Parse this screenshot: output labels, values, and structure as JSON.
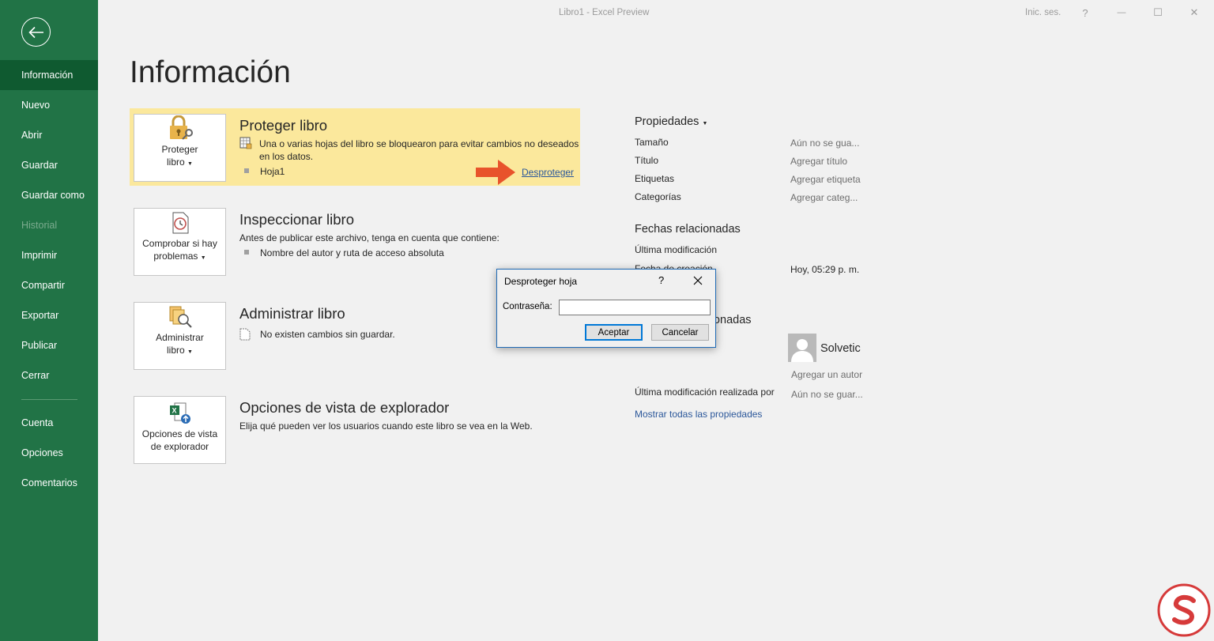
{
  "window": {
    "title": "Libro1  -  Excel Preview",
    "sign_in": "Inic. ses.",
    "help_glyph": "?",
    "minimize_glyph": "—",
    "maximize_glyph": "☐",
    "close_glyph": "✕"
  },
  "sidebar": {
    "items": [
      {
        "label": "Información",
        "state": "active"
      },
      {
        "label": "Nuevo",
        "state": "normal"
      },
      {
        "label": "Abrir",
        "state": "normal"
      },
      {
        "label": "Guardar",
        "state": "normal"
      },
      {
        "label": "Guardar como",
        "state": "normal"
      },
      {
        "label": "Historial",
        "state": "disabled"
      },
      {
        "label": "Imprimir",
        "state": "normal"
      },
      {
        "label": "Compartir",
        "state": "normal"
      },
      {
        "label": "Exportar",
        "state": "normal"
      },
      {
        "label": "Publicar",
        "state": "normal"
      },
      {
        "label": "Cerrar",
        "state": "normal"
      },
      {
        "label": "Cuenta",
        "state": "normal"
      },
      {
        "label": "Opciones",
        "state": "normal"
      },
      {
        "label": "Comentarios",
        "state": "normal"
      }
    ]
  },
  "page": {
    "title": "Información"
  },
  "sections": {
    "protect": {
      "button_line1": "Proteger",
      "button_line2": "libro",
      "title": "Proteger libro",
      "desc_line1": "Una o varias hojas del libro se bloquearon para evitar cambios no deseados",
      "desc_line2": "en los datos.",
      "sheet": "Hoja1",
      "unprotect_link": "Desproteger",
      "highlight_color": "#fbe89c"
    },
    "inspect": {
      "button_line1": "Comprobar si hay",
      "button_line2": "problemas",
      "title": "Inspeccionar libro",
      "desc": "Antes de publicar este archivo, tenga en cuenta que contiene:",
      "item": "Nombre del autor y ruta de acceso absoluta"
    },
    "manage": {
      "button_line1": "Administrar",
      "button_line2": "libro",
      "title": "Administrar libro",
      "desc": "No existen cambios sin guardar."
    },
    "browser": {
      "button_line1": "Opciones de vista",
      "button_line2": "de explorador",
      "title": "Opciones de vista de explorador",
      "desc": "Elija qué pueden ver los usuarios cuando este libro se vea en la Web."
    }
  },
  "properties": {
    "heading": "Propiedades",
    "rows": [
      {
        "label": "Tamaño",
        "value": "Aún no se gua..."
      },
      {
        "label": "Título",
        "value": "Agregar título"
      },
      {
        "label": "Etiquetas",
        "value": "Agregar etiqueta"
      },
      {
        "label": "Categorías",
        "value": "Agregar categ..."
      }
    ],
    "dates_heading": "Fechas relacionadas",
    "last_modified_label": "Última modificación",
    "created_label": "Fecha de creación",
    "created_value": "Hoy, 05:29 p. m.",
    "people_heading": "Personas relacionadas",
    "author_name": "Solvetic",
    "add_author": "Agregar un autor",
    "last_modified_by_label": "Última modificación realizada por",
    "last_modified_by_value": "Aún no se guar...",
    "show_all": "Mostrar todas las propiedades"
  },
  "dialog": {
    "title": "Desproteger hoja",
    "help": "?",
    "password_label": "Contraseña:",
    "password_value": "",
    "ok_label": "Aceptar",
    "cancel_label": "Cancelar"
  },
  "colors": {
    "sidebar": "#217346",
    "sidebar_active": "#0f5a30",
    "link": "#2b579a",
    "arrow": "#e8532b"
  }
}
